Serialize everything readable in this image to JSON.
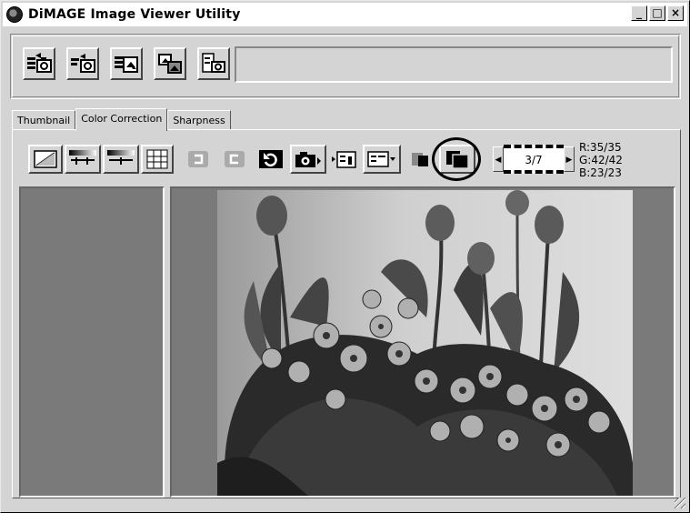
{
  "window": {
    "title": "DiMAGE Image Viewer Utility",
    "minimize": "_",
    "maximize": "□",
    "close": "×"
  },
  "toolbar": {
    "buttons": [
      {
        "name": "transfer-images-icon"
      },
      {
        "name": "camera-import-icon"
      },
      {
        "name": "batch-transfer-icon"
      },
      {
        "name": "convert-images-icon"
      },
      {
        "name": "camera-settings-icon"
      }
    ],
    "info_text": ""
  },
  "tabs": [
    {
      "label": "Thumbnail",
      "active": false
    },
    {
      "label": "Color Correction",
      "active": true
    },
    {
      "label": "Sharpness",
      "active": false
    }
  ],
  "correction_tools": {
    "frame_counter": "3/7",
    "rgb": {
      "r": "R:35/35",
      "g": "G:42/42",
      "b": "B:23/23"
    }
  },
  "colors": {
    "window_bg": "#d4d4d4",
    "pane_bg": "#7a7a7a",
    "highlight": "#000000"
  }
}
